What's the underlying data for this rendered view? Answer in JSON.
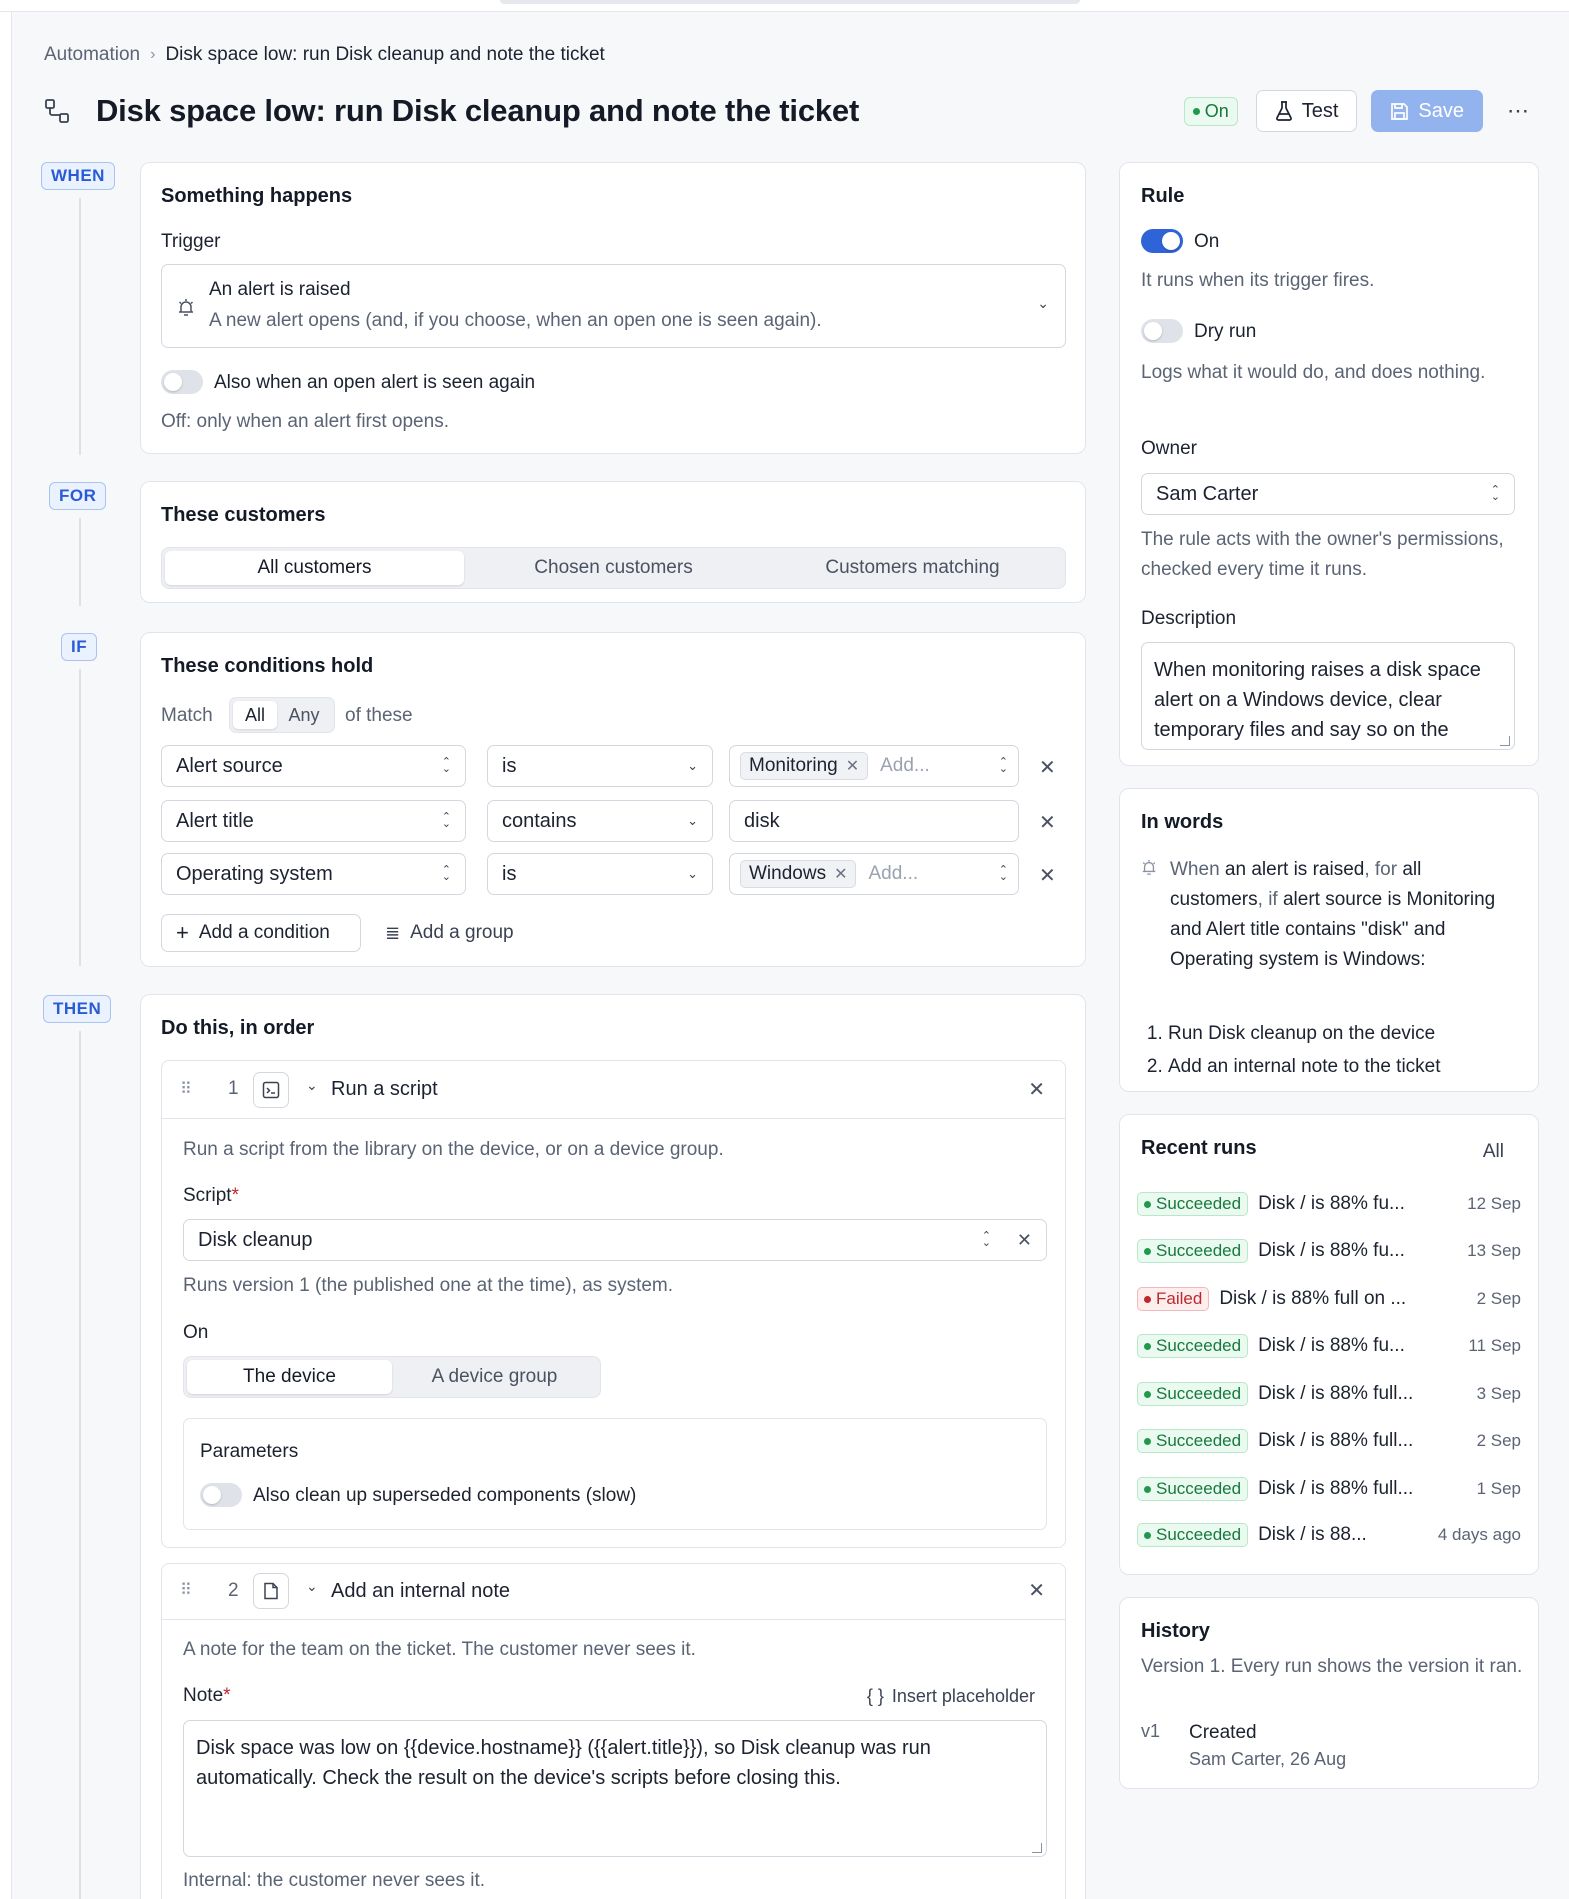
{
  "breadcrumb": {
    "parent": "Automation",
    "current": "Disk space low: run Disk cleanup and note the ticket"
  },
  "header": {
    "title": "Disk space low: run Disk cleanup and note the ticket",
    "status_badge": "On",
    "test_label": "Test",
    "save_label": "Save",
    "more_icon": "more-horizontal-icon"
  },
  "rail": {
    "when": "WHEN",
    "for": "FOR",
    "if": "IF",
    "then": "THEN"
  },
  "when": {
    "heading": "Something happens",
    "trigger_label": "Trigger",
    "trigger_title": "An alert is raised",
    "trigger_desc": "A new alert opens (and, if you choose, when an open one is seen again).",
    "seen_again_label": "Also when an open alert is seen again",
    "seen_again_hint": "Off: only when an alert first opens."
  },
  "for": {
    "heading": "These customers",
    "options": [
      "All customers",
      "Chosen customers",
      "Customers matching"
    ],
    "selected": "All customers"
  },
  "if": {
    "heading": "These conditions hold",
    "match_label": "Match",
    "match_all": "All",
    "match_any": "Any",
    "match_suffix": "of these",
    "rows": [
      {
        "field": "Alert source",
        "op": "is",
        "chip": "Monitoring",
        "placeholder": "Add..."
      },
      {
        "field": "Alert title",
        "op": "contains",
        "value": "disk"
      },
      {
        "field": "Operating system",
        "op": "is",
        "chip": "Windows",
        "placeholder": "Add..."
      }
    ],
    "add_condition": "Add a condition",
    "add_group": "Add a group"
  },
  "then": {
    "heading": "Do this, in order",
    "step1": {
      "num": "1",
      "title": "Run a script",
      "desc": "Run a script from the library on the device, or on a device group.",
      "script_label": "Script",
      "required": "*",
      "script_value": "Disk cleanup",
      "script_hint": "Runs version 1 (the published one at the time), as system.",
      "on_label": "On",
      "on_options": [
        "The device",
        "A device group"
      ],
      "params_label": "Parameters",
      "param_toggle": "Also clean up superseded components (slow)"
    },
    "step2": {
      "num": "2",
      "title": "Add an internal note",
      "desc": "A note for the team on the ticket. The customer never sees it.",
      "note_label": "Note",
      "required": "*",
      "insert_placeholder": "Insert placeholder",
      "note_text": "Disk space was low on {{device.hostname}} ({{alert.title}}), so Disk cleanup was run automatically. Check the result on the device's scripts before closing this.",
      "note_hint": "Internal: the customer never sees it."
    }
  },
  "rule": {
    "heading": "Rule",
    "on_label": "On",
    "on_hint": "It runs when its trigger fires.",
    "dry_label": "Dry run",
    "dry_hint": "Logs what it would do, and does nothing.",
    "owner_label": "Owner",
    "owner_value": "Sam Carter",
    "owner_hint": "The rule acts with the owner's permissions, checked every time it runs.",
    "desc_label": "Description",
    "desc_value": "When monitoring raises a disk space alert on a Windows device, clear temporary files and say so on the ticket."
  },
  "in_words": {
    "heading": "In words",
    "t1": "When ",
    "b1": "an alert is raised",
    "t2": ", for ",
    "b2": "all customers",
    "t3": ", if ",
    "b3": "alert source is Monitoring and Alert title contains \"disk\" and Operating system is Windows",
    "t4": ":",
    "steps": [
      "Run Disk cleanup on the device",
      "Add an internal note to the ticket"
    ]
  },
  "recent_runs": {
    "heading": "Recent runs",
    "all_link": "All",
    "runs": [
      {
        "status": "Succeeded",
        "title": "Disk / is 88% fu...",
        "date": "12 Sep"
      },
      {
        "status": "Succeeded",
        "title": "Disk / is 88% fu...",
        "date": "13 Sep"
      },
      {
        "status": "Failed",
        "title": "Disk / is 88% full on ...",
        "date": "2 Sep"
      },
      {
        "status": "Succeeded",
        "title": "Disk / is 88% fu...",
        "date": "11 Sep"
      },
      {
        "status": "Succeeded",
        "title": "Disk / is 88% full...",
        "date": "3 Sep"
      },
      {
        "status": "Succeeded",
        "title": "Disk / is 88% full...",
        "date": "2 Sep"
      },
      {
        "status": "Succeeded",
        "title": "Disk / is 88% full...",
        "date": "1 Sep"
      },
      {
        "status": "Succeeded",
        "title": "Disk / is 88...",
        "date": "4 days ago"
      }
    ]
  },
  "history": {
    "heading": "History",
    "desc": "Version 1. Every run shows the version it ran.",
    "version": "v1",
    "event": "Created",
    "meta": "Sam Carter, 26 Aug"
  },
  "colors": {
    "accent": "#2f63d8",
    "success": "#177a3c",
    "danger": "#c0262d",
    "rail": "#2a5bd7"
  }
}
